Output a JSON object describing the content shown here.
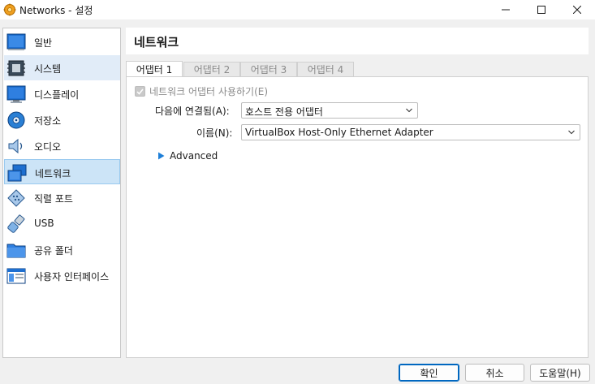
{
  "window": {
    "title": "Networks - 설정",
    "minimize_icon": "minimize-icon",
    "maximize_icon": "maximize-icon",
    "close_icon": "close-icon"
  },
  "sidebar": {
    "items": [
      {
        "label": "일반",
        "icon": "general-icon"
      },
      {
        "label": "시스템",
        "icon": "system-icon"
      },
      {
        "label": "디스플레이",
        "icon": "display-icon"
      },
      {
        "label": "저장소",
        "icon": "storage-icon"
      },
      {
        "label": "오디오",
        "icon": "audio-icon"
      },
      {
        "label": "네트워크",
        "icon": "network-icon"
      },
      {
        "label": "직렬 포트",
        "icon": "serial-port-icon"
      },
      {
        "label": "USB",
        "icon": "usb-icon"
      },
      {
        "label": "공유 폴더",
        "icon": "shared-folder-icon"
      },
      {
        "label": "사용자 인터페이스",
        "icon": "user-interface-icon"
      }
    ]
  },
  "main": {
    "title": "네트워크",
    "tabs": [
      {
        "label": "어댑터 1"
      },
      {
        "label": "어댑터 2"
      },
      {
        "label": "어댑터 3"
      },
      {
        "label": "어댑터 4"
      }
    ],
    "enable_label": "네트워크 어댑터 사용하기(E)",
    "attached_label": "다음에 연결됨(A):",
    "attached_value": "호스트 전용 어댑터",
    "name_label": "이름(N):",
    "name_value": "VirtualBox Host-Only Ethernet Adapter",
    "advanced_label": "Advanced"
  },
  "buttons": {
    "ok": "확인",
    "cancel": "취소",
    "help": "도움말(H)"
  },
  "colors": {
    "accent": "#0067c0",
    "selected_bg": "#cce4f7",
    "disabled_text": "#8a8a8a"
  }
}
